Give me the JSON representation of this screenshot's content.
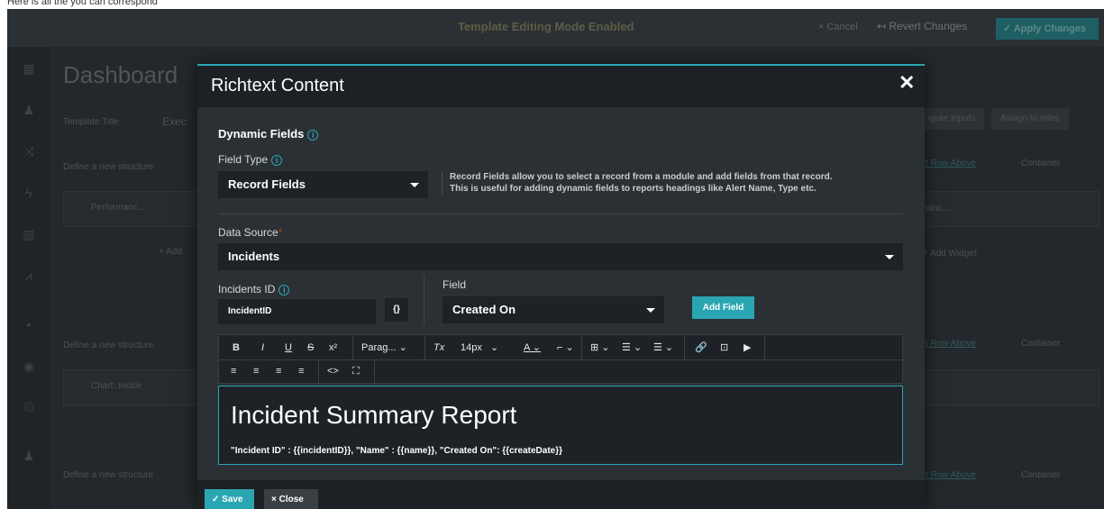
{
  "caption": "Here is all the you can correspond",
  "topbar": {
    "mode_text": "Template Editing Mode Enabled",
    "cancel_label": "× Cancel",
    "revert_label": "↤ Revert Changes",
    "apply_label": "✓ Apply Changes"
  },
  "background": {
    "page_title": "Dashboard",
    "template_title_label": "Template Title",
    "template_title_value": "Exec",
    "define_structure_label": "Define a new structure",
    "widget1_label": "Performanc...",
    "widget1_right_label": "rmanc...",
    "add_label": "+ Add",
    "add_widget_label": "+ Add Widget",
    "chart_label": "Chart: Incide",
    "configure_inputs_label": "igure Inputs",
    "assign_roles_label": "Assign to roles",
    "insert_row_above_label": "ert Row Above",
    "container_label": "Container"
  },
  "modal": {
    "title": "Richtext Content",
    "dynamic_fields_label": "Dynamic Fields",
    "field_type_label": "Field Type",
    "field_type_value": "Record Fields",
    "field_type_help_line1": "Record Fields allow you to select a record from a module and add fields from that record.",
    "field_type_help_line2": "This is useful for adding dynamic fields to reports headings like Alert Name, Type etc.",
    "data_source_label": "Data Source",
    "data_source_value": "Incidents",
    "incidents_id_label": "Incidents ID",
    "incidents_id_value": "IncidentID",
    "brace_label": "{}",
    "field_label": "Field",
    "field_value": "Created On",
    "add_field_label": "Add Field",
    "toolbar": {
      "bold": "B",
      "italic": "I",
      "underline": "U",
      "strike": "S",
      "superscript": "x²",
      "paragraph": "Parag...",
      "clear_format": "Tx",
      "font_size": "14px",
      "font_color": "A",
      "highlight": "⌐",
      "table": "⊞",
      "bullet_list": "☰",
      "numbered_list": "☰",
      "link": "🔗",
      "image": "⊡",
      "media": "▶",
      "align_left": "≡",
      "align_center": "≡",
      "align_right": "≡",
      "align_justify": "≡",
      "code": "<>",
      "fullscreen": "⛶"
    },
    "editor_heading": "Incident Summary Report",
    "editor_body": "\"Incident ID\" : {{incidentID}}, \"Name\" : {{name}},  \"Created On\": {{createDate}}",
    "save_label": "✓ Save",
    "close_label": "× Close"
  }
}
